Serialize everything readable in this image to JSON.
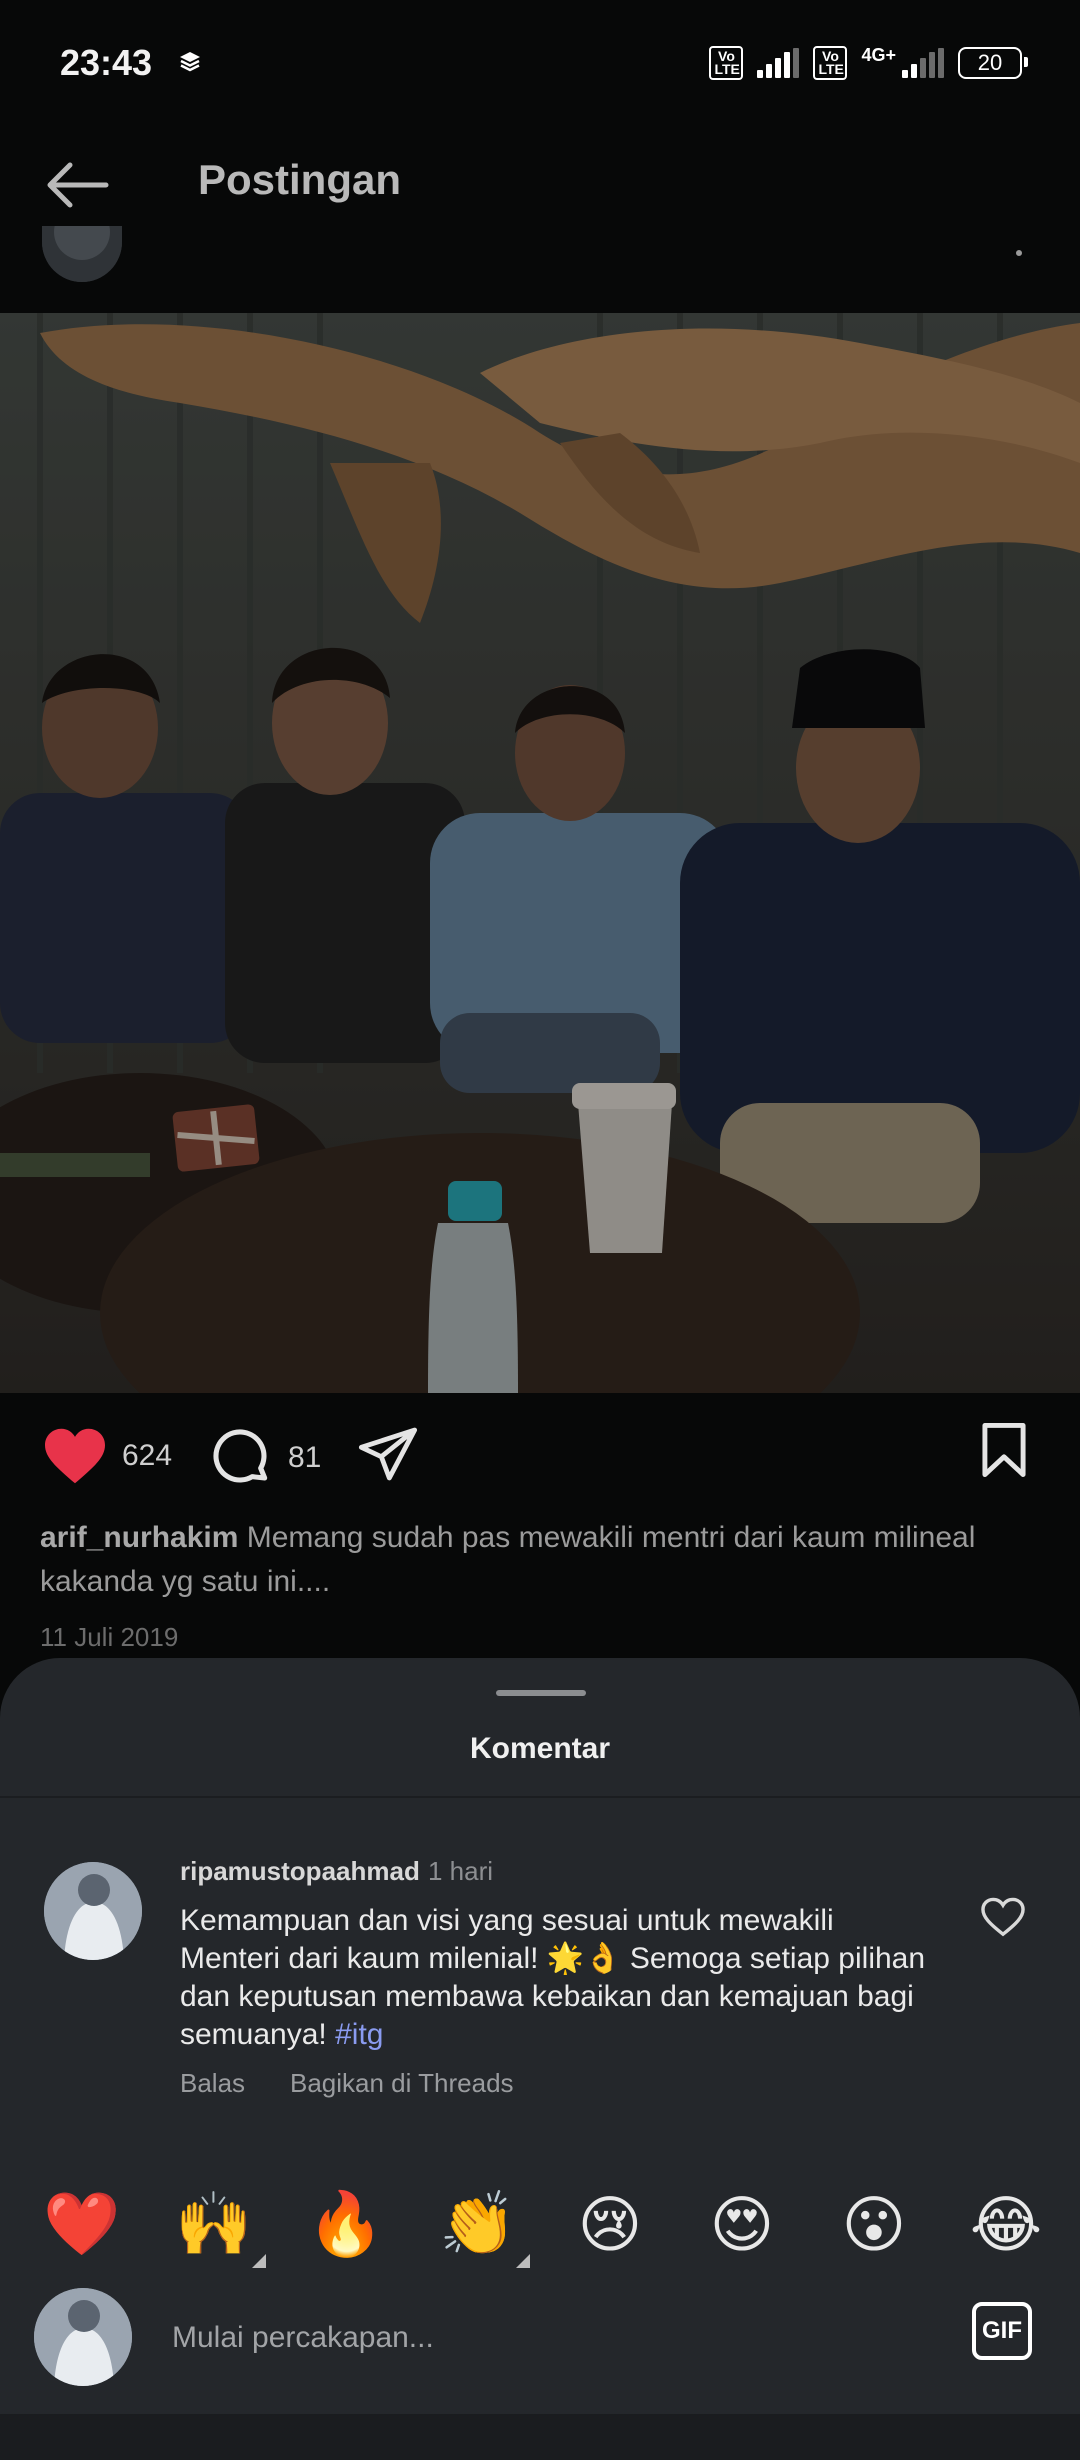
{
  "status_bar": {
    "time": "23:43",
    "volte_1": "Vo LTE",
    "volte_2": "Vo LTE",
    "network": "4G+",
    "battery": "20"
  },
  "header": {
    "title": "Postingan"
  },
  "post": {
    "likes": "624",
    "comments": "81",
    "caption_user": "arif_nurhakim",
    "caption_text": "Memang sudah pas mewakili mentri dari kaum milineal kakanda yg satu ini....",
    "date": "11 Juli 2019",
    "liked": true
  },
  "comments_sheet": {
    "title": "Komentar",
    "comment": {
      "user": "ripamustopaahmad",
      "time": "1 hari",
      "text": "Kemampuan dan visi yang sesuai untuk mewakili Menteri dari kaum milenial! 🌟👌 Semoga setiap pilihan dan keputusan membawa kebaikan dan kemajuan bagi semuanya! ",
      "hashtag": "#itg",
      "reply_label": "Balas",
      "share_label": "Bagikan di Threads"
    },
    "emojis": [
      "❤️",
      "🙌",
      "🔥",
      "👏",
      "😢",
      "😍",
      "😮",
      "😂"
    ],
    "composer_placeholder": "Mulai percakapan...",
    "gif_label": "GIF"
  },
  "colors": {
    "like": "#e8334a",
    "hashtag": "#8a9bf0",
    "sheet": "#24272b"
  }
}
